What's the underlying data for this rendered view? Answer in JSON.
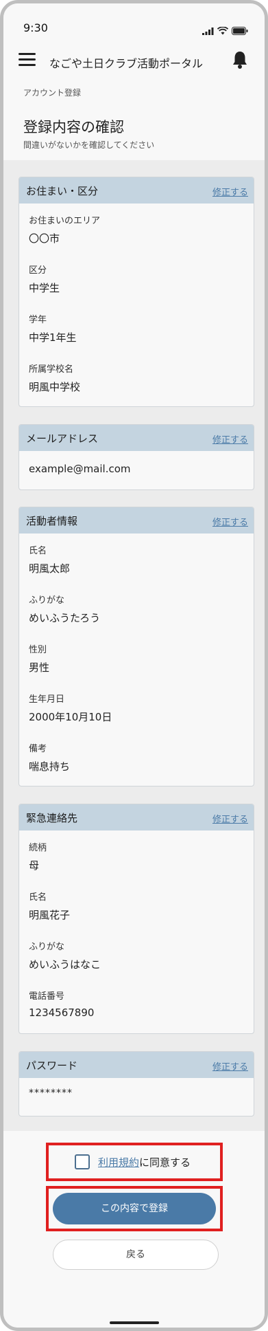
{
  "status": {
    "time": "9:30"
  },
  "header": {
    "title": "なごや土日クラブ活動ポータル"
  },
  "intro": {
    "breadcrumb": "アカウント登録",
    "title": "登録内容の確認",
    "subtitle": "間違いがないかを確認してください"
  },
  "edit_label": "修正する",
  "cards": {
    "residence": {
      "title": "お住まい・区分",
      "fields": [
        {
          "label": "お住まいのエリア",
          "value": "〇〇市"
        },
        {
          "label": "区分",
          "value": "中学生"
        },
        {
          "label": "学年",
          "value": "中学1年生"
        },
        {
          "label": "所属学校名",
          "value": "明風中学校"
        }
      ]
    },
    "email": {
      "title": "メールアドレス",
      "value": "example@mail.com"
    },
    "member": {
      "title": "活動者情報",
      "fields": [
        {
          "label": "氏名",
          "value": "明風太郎"
        },
        {
          "label": "ふりがな",
          "value": "めいふうたろう"
        },
        {
          "label": "性別",
          "value": "男性"
        },
        {
          "label": "生年月日",
          "value": "2000年10月10日"
        },
        {
          "label": "備考",
          "value": "喘息持ち"
        }
      ]
    },
    "emergency": {
      "title": "緊急連絡先",
      "fields": [
        {
          "label": "続柄",
          "value": "母"
        },
        {
          "label": "氏名",
          "value": "明風花子"
        },
        {
          "label": "ふりがな",
          "value": "めいふうはなこ"
        },
        {
          "label": "電話番号",
          "value": "1234567890"
        }
      ]
    },
    "password": {
      "title": "パスワード",
      "value": "********"
    }
  },
  "footer": {
    "terms_link": "利用規約",
    "terms_suffix": "に同意する",
    "submit_label": "この内容で登録",
    "back_label": "戻る"
  },
  "colors": {
    "accent": "#4a7aa7",
    "card_header": "#c4d4e0",
    "highlight": "#e02020"
  }
}
